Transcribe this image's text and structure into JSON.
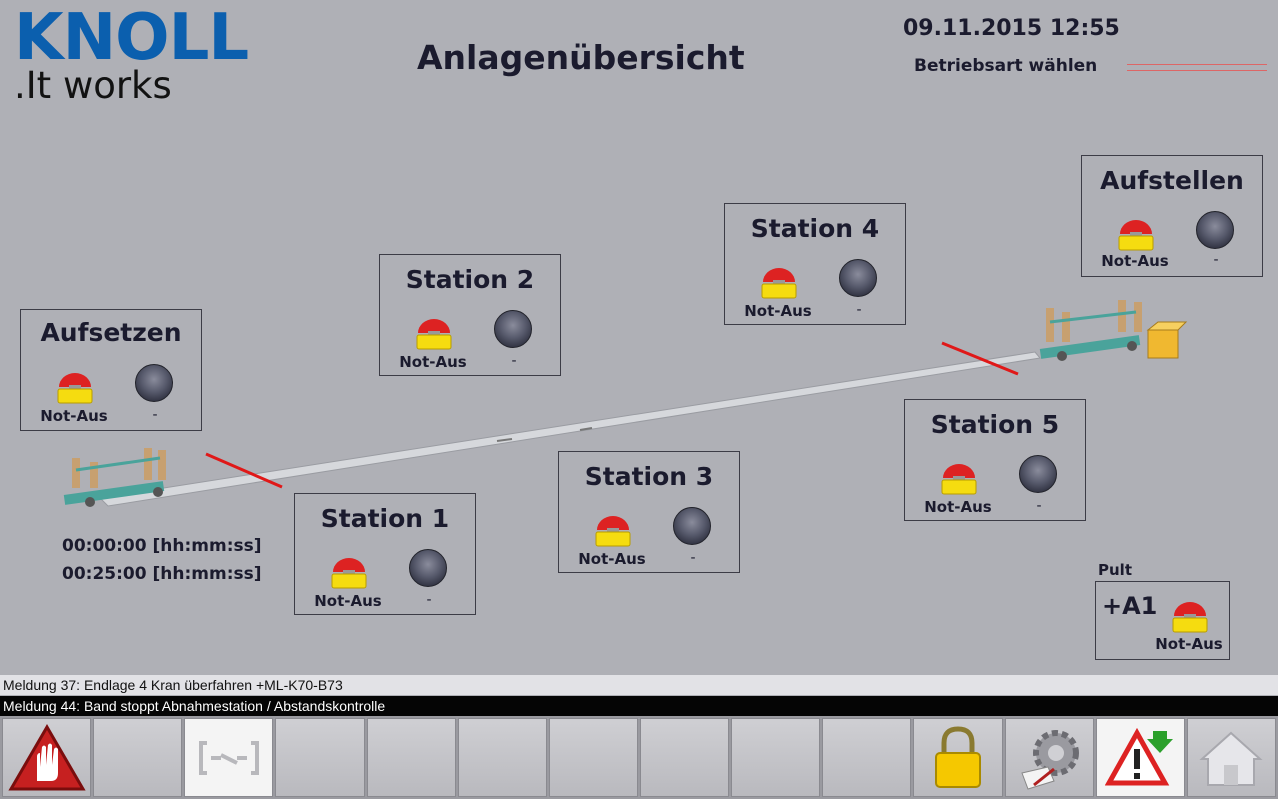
{
  "logo": {
    "main": "KNOLL",
    "sub": ".It works"
  },
  "header": {
    "title": "Anlagenübersicht",
    "datetime": "09.11.2015 12:55",
    "mode_label": "Betriebsart wählen"
  },
  "stations": [
    {
      "name": "Aufsetzen",
      "estop_label": "Not-Aus",
      "status": "-"
    },
    {
      "name": "Station 1",
      "estop_label": "Not-Aus",
      "status": "-"
    },
    {
      "name": "Station 2",
      "estop_label": "Not-Aus",
      "status": "-"
    },
    {
      "name": "Station 3",
      "estop_label": "Not-Aus",
      "status": "-"
    },
    {
      "name": "Station 4",
      "estop_label": "Not-Aus",
      "status": "-"
    },
    {
      "name": "Station 5",
      "estop_label": "Not-Aus",
      "status": "-"
    },
    {
      "name": "Aufstellen",
      "estop_label": "Not-Aus",
      "status": "-"
    }
  ],
  "timers": [
    "00:00:00 [hh:mm:ss]",
    "00:25:00 [hh:mm:ss]"
  ],
  "pult": {
    "label": "Pult",
    "name": "+A1",
    "estop_label": "Not-Aus"
  },
  "messages": [
    "Meldung 37: Endlage 4 Kran überfahren +ML-K70-B73",
    "Meldung 44: Band stoppt Abnahmestation / Abstandskontrolle"
  ],
  "toolbar": {
    "buttons": [
      "stop-hand-icon",
      "empty",
      "conveyor-icon",
      "empty",
      "empty",
      "empty",
      "empty",
      "empty",
      "empty",
      "empty",
      "lock-icon",
      "settings-icon",
      "alarm-icon",
      "home-icon"
    ]
  },
  "colors": {
    "background": "#afb0b6",
    "logo_blue": "#0b5fae",
    "estop_red": "#d22",
    "estop_yellow": "#f5dc10"
  }
}
